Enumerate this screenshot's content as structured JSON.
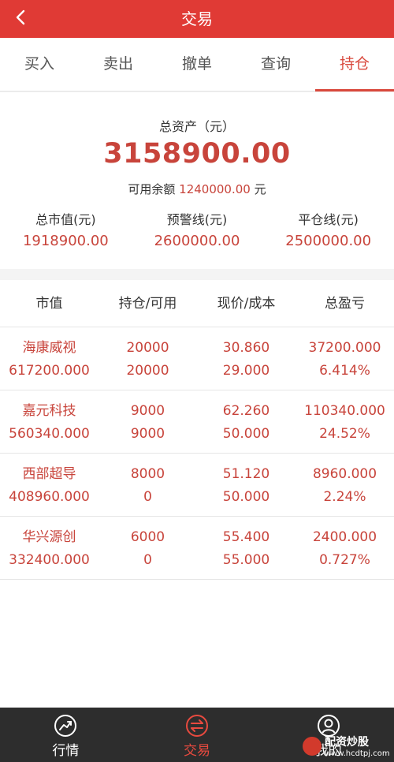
{
  "header": {
    "back_icon": "chevron-left-icon",
    "title": "交易"
  },
  "tabs": [
    {
      "label": "买入"
    },
    {
      "label": "卖出"
    },
    {
      "label": "撤单"
    },
    {
      "label": "查询"
    },
    {
      "label": "持仓",
      "active": true
    }
  ],
  "summary": {
    "total_label": "总资产（元）",
    "total_value": "3158900.00",
    "available_prefix": "可用余额",
    "available_amount": "1240000.00",
    "available_suffix": "元",
    "stats": [
      {
        "label": "总市值(元)",
        "value": "1918900.00"
      },
      {
        "label": "预警线(元)",
        "value": "2600000.00"
      },
      {
        "label": "平仓线(元)",
        "value": "2500000.00"
      }
    ]
  },
  "positions": {
    "headers": [
      "市值",
      "持仓/可用",
      "现价/成本",
      "总盈亏"
    ],
    "rows": [
      {
        "name": "海康威视",
        "market_value": "617200.000",
        "holding": "20000",
        "available": "20000",
        "price": "30.860",
        "cost": "29.000",
        "pnl": "37200.000",
        "pnl_pct": "6.414%"
      },
      {
        "name": "嘉元科技",
        "market_value": "560340.000",
        "holding": "9000",
        "available": "9000",
        "price": "62.260",
        "cost": "50.000",
        "pnl": "110340.000",
        "pnl_pct": "24.52%"
      },
      {
        "name": "西部超导",
        "market_value": "408960.000",
        "holding": "8000",
        "available": "0",
        "price": "51.120",
        "cost": "50.000",
        "pnl": "8960.000",
        "pnl_pct": "2.24%"
      },
      {
        "name": "华兴源创",
        "market_value": "332400.000",
        "holding": "6000",
        "available": "0",
        "price": "55.400",
        "cost": "55.000",
        "pnl": "2400.000",
        "pnl_pct": "0.727%"
      }
    ]
  },
  "bottom_nav": [
    {
      "label": "行情",
      "icon": "chart-trend-icon"
    },
    {
      "label": "交易",
      "icon": "exchange-icon",
      "active": true
    },
    {
      "label": "我的",
      "icon": "user-icon"
    }
  ],
  "watermark": {
    "line1": "配资炒股",
    "line2": "www.hcdtpj.com"
  },
  "colors": {
    "brand": "#e03a35",
    "value_red": "#c8443b",
    "tabbar": "#2d2d2d"
  }
}
